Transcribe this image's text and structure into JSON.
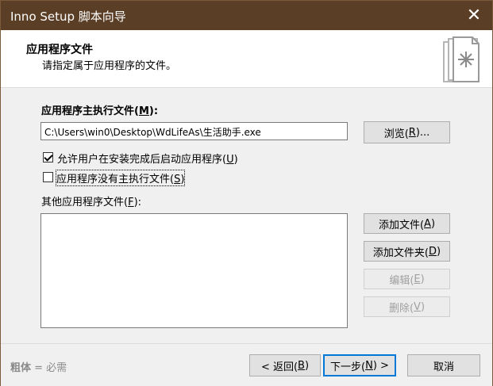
{
  "window": {
    "title": "Inno Setup 脚本向导"
  },
  "header": {
    "title": "应用程序文件",
    "subtitle": "请指定属于应用程序的文件。"
  },
  "main_exe": {
    "label_pre": "应用程序主执行文件(",
    "label_key": "M",
    "label_post": "):",
    "value": "C:\\Users\\win0\\Desktop\\WdLifeAs\\生活助手.exe",
    "browse_pre": "浏览(",
    "browse_key": "R",
    "browse_post": ")..."
  },
  "options": {
    "allow_run": {
      "pre": "允许用户在安装完成后启动应用程序(",
      "key": "U",
      "post": ")",
      "checked": true
    },
    "no_main_exe": {
      "pre": "应用程序没有主执行文件(",
      "key": "S",
      "post": ")",
      "checked": false
    }
  },
  "other_files": {
    "label_pre": "其他应用程序文件(",
    "label_key": "F",
    "label_post": "):",
    "items": []
  },
  "side_buttons": {
    "add_file": {
      "pre": "添加文件(",
      "key": "A",
      "post": ")"
    },
    "add_folder": {
      "pre": "添加文件夹(",
      "key": "D",
      "post": ")"
    },
    "edit": {
      "pre": "编辑(",
      "key": "E",
      "post": ")"
    },
    "delete": {
      "pre": "删除(",
      "key": "V",
      "post": ")"
    }
  },
  "footer": {
    "legend_bold": "粗体",
    "legend_rest": " = 必需",
    "back": {
      "pre": "< 返回(",
      "key": "B",
      "post": ")"
    },
    "next": {
      "pre": "下一步(",
      "key": "N",
      "post": ") >"
    },
    "cancel": "取消"
  },
  "icons": {
    "close": "close-icon",
    "header": "document-icon"
  }
}
